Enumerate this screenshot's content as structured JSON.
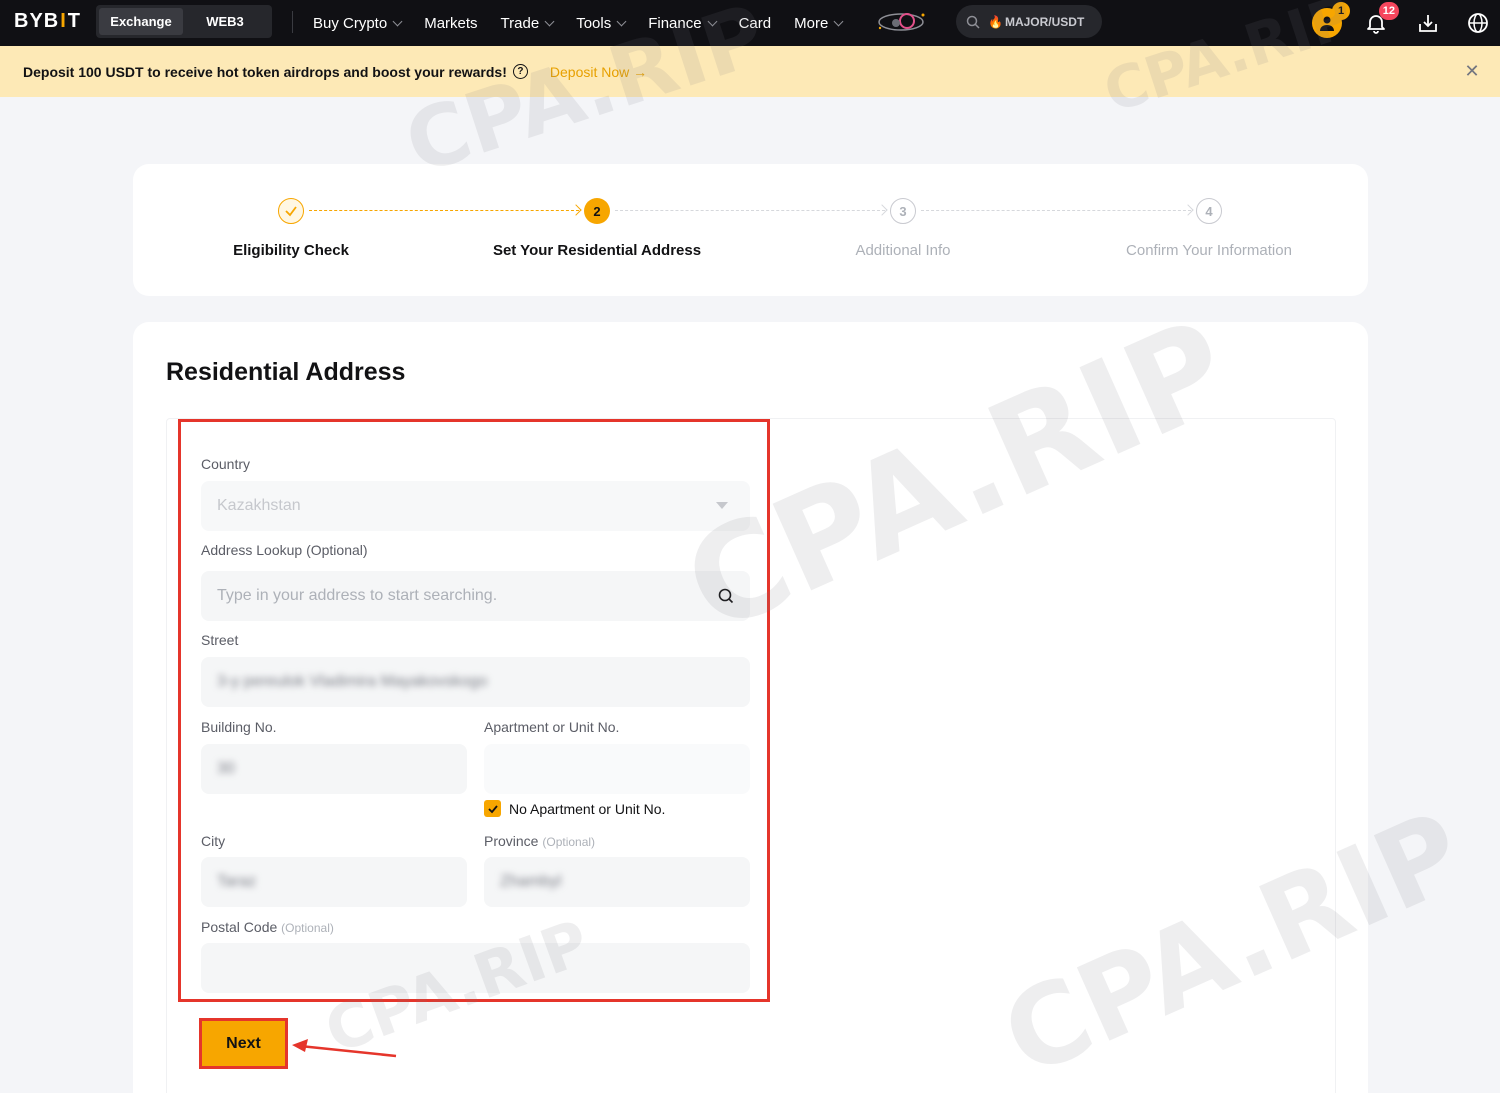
{
  "brand": {
    "logo_prefix": "BYB",
    "logo_i": "I",
    "logo_suffix": "T"
  },
  "nav": {
    "switch": [
      "Exchange",
      "WEB3"
    ],
    "menu": [
      {
        "label": "Buy Crypto",
        "dropdown": true
      },
      {
        "label": "Markets",
        "dropdown": false
      },
      {
        "label": "Trade",
        "dropdown": true
      },
      {
        "label": "Tools",
        "dropdown": true
      },
      {
        "label": "Finance",
        "dropdown": true
      },
      {
        "label": "Card",
        "dropdown": false
      },
      {
        "label": "More",
        "dropdown": true
      }
    ],
    "search_text": "MAJOR/USDT",
    "rewards_badge": "1",
    "notifications_badge": "12",
    "icons": [
      "search-icon",
      "fire-icon",
      "rewards-icon",
      "bell-icon",
      "download-icon",
      "globe-icon"
    ]
  },
  "banner": {
    "message": "Deposit 100 USDT to receive hot token airdrops and boost your rewards!",
    "cta": "Deposit Now",
    "help_glyph": "?",
    "close_glyph": "✕"
  },
  "steps": [
    {
      "number": "1",
      "label": "Eligibility Check",
      "state": "done"
    },
    {
      "number": "2",
      "label": "Set Your Residential Address",
      "state": "current"
    },
    {
      "number": "3",
      "label": "Additional Info",
      "state": "pending"
    },
    {
      "number": "4",
      "label": "Confirm Your Information",
      "state": "pending"
    }
  ],
  "form": {
    "title": "Residential Address",
    "country": {
      "label": "Country",
      "value": "Kazakhstan"
    },
    "lookup": {
      "label": "Address Lookup (Optional)",
      "placeholder": "Type in your address to start searching."
    },
    "street": {
      "label": "Street",
      "value": "3-y pereulok Vladimira Mayakovskogo"
    },
    "building": {
      "label": "Building No.",
      "value": "30"
    },
    "apartment": {
      "label": "Apartment or Unit No.",
      "value": ""
    },
    "no_apartment": {
      "label": "No Apartment or Unit No.",
      "checked": true
    },
    "city": {
      "label": "City",
      "value": "Taraz"
    },
    "province": {
      "label": "Province",
      "optional": "(Optional)",
      "value": "Zhambyl"
    },
    "postal": {
      "label": "Postal Code",
      "optional": "(Optional)",
      "value": ""
    },
    "next_label": "Next"
  },
  "watermark_text": "CPA.RIP",
  "colors": {
    "accent": "#f7a600",
    "annotation_red": "#e5352b",
    "nav_bg": "#101014",
    "banner_bg": "#fde9b6"
  }
}
